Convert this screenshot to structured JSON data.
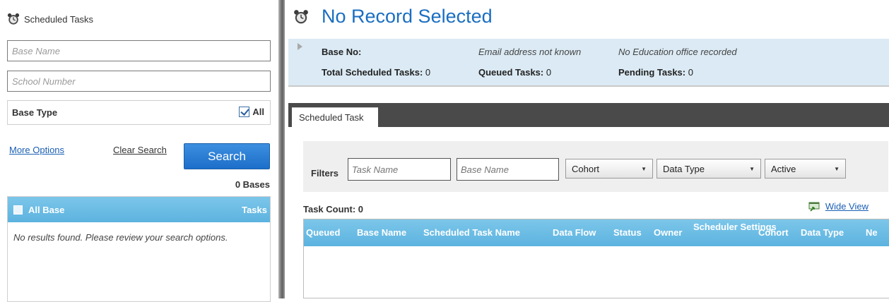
{
  "left_panel": {
    "title": "Scheduled Tasks",
    "base_name_placeholder": "Base Name",
    "school_number_placeholder": "School Number",
    "base_type_label": "Base Type",
    "base_type_all_label": "All",
    "more_options": "More Options",
    "clear_search": "Clear Search",
    "search_button": "Search",
    "bases_count": "0 Bases",
    "results_header": {
      "all_base": "All  Base",
      "tasks": "Tasks"
    },
    "no_results": "No results found. Please review your search options."
  },
  "right_panel": {
    "title": "No Record Selected",
    "info": {
      "base_no_label": "Base No:",
      "email": "Email address not known",
      "education_office": "No Education office recorded",
      "total_scheduled_label": "Total Scheduled Tasks:",
      "total_scheduled_value": "0",
      "queued_label": "Queued Tasks:",
      "queued_value": "0",
      "pending_label": "Pending Tasks:",
      "pending_value": "0"
    },
    "tab_label": "Scheduled Task",
    "filters": {
      "label": "Filters",
      "task_name_placeholder": "Task Name",
      "base_name_placeholder": "Base Name",
      "cohort": "Cohort",
      "data_type": "Data Type",
      "active": "Active"
    },
    "task_count": "Task Count: 0",
    "wide_view": "Wide View",
    "grid_columns": [
      "Queued",
      "Base Name",
      "Scheduled Task Name",
      "Data Flow",
      "Status",
      "Owner",
      "Scheduler Settings",
      "Cohort",
      "Data Type",
      "Ne"
    ]
  },
  "colors": {
    "accent_blue": "#1a6ec1",
    "header_blue": "#5cb3df",
    "info_bg": "#dbeaf4",
    "tabbar": "#4a4a4a"
  }
}
